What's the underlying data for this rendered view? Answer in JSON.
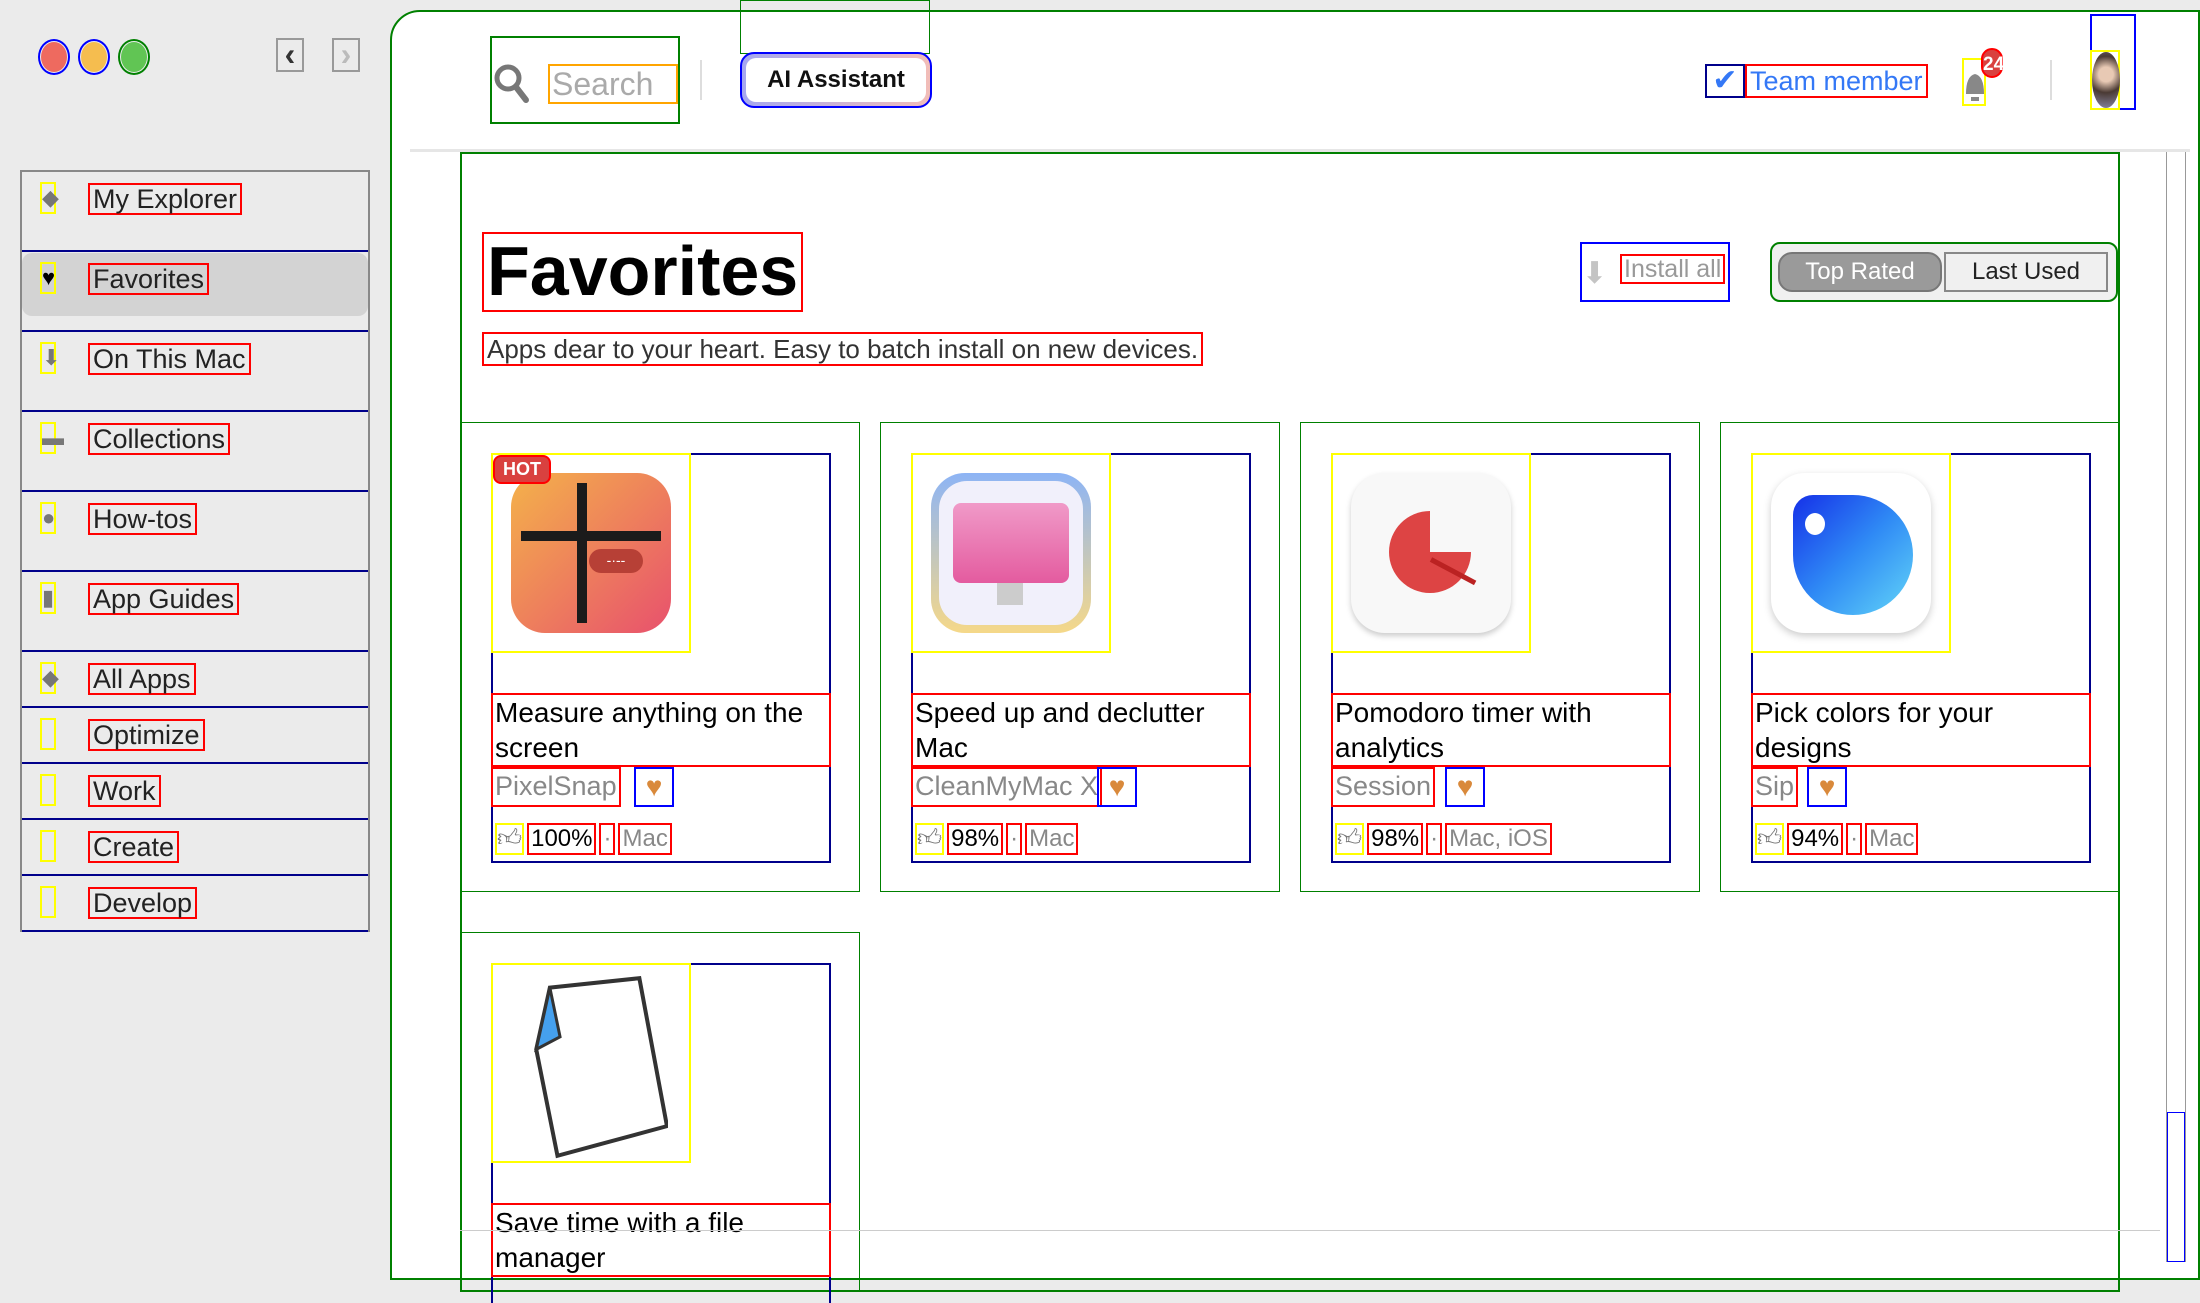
{
  "window": {
    "controls": [
      "close",
      "minimize",
      "zoom"
    ],
    "colors": {
      "close": "#ee6a5f",
      "minimize": "#f5bd4f",
      "zoom": "#61c554"
    }
  },
  "nav": {
    "back": "‹",
    "forward": "›"
  },
  "sidebar": {
    "items": [
      {
        "label": "My Explorer",
        "icon": "explorer-icon",
        "glyph": "◆"
      },
      {
        "label": "Favorites",
        "icon": "heart-icon",
        "glyph": "♥",
        "active": true
      },
      {
        "label": "On This Mac",
        "icon": "download-arrow-icon",
        "glyph": "⬇"
      },
      {
        "label": "Collections",
        "icon": "folder-icon",
        "glyph": "▬"
      },
      {
        "label": "How-tos",
        "icon": "lightbulb-icon",
        "glyph": "●"
      },
      {
        "label": "App Guides",
        "icon": "book-icon",
        "glyph": "▮"
      },
      {
        "label": "All Apps",
        "icon": "diamond-icon",
        "glyph": "◆"
      },
      {
        "label": "Optimize",
        "icon": "optimize-icon",
        "glyph": ""
      },
      {
        "label": "Work",
        "icon": "work-icon",
        "glyph": ""
      },
      {
        "label": "Create",
        "icon": "create-icon",
        "glyph": ""
      },
      {
        "label": "Develop",
        "icon": "develop-icon",
        "glyph": ""
      }
    ]
  },
  "header": {
    "search_placeholder": "Search",
    "ai_button": "AI Assistant",
    "team_member": "Team member",
    "notifications_count": "24",
    "accent": "#3478f6"
  },
  "page": {
    "title": "Favorites",
    "subtitle": "Apps dear to your heart. Easy to batch install on new devices.",
    "install_all": "Install all",
    "segments": [
      "Top Rated",
      "Last Used"
    ],
    "selected_segment": "Top Rated"
  },
  "apps": [
    {
      "title": "Measure anything on the screen",
      "developer": "PixelSnap",
      "rating": "100%",
      "platforms": "Mac",
      "badge": "HOT"
    },
    {
      "title": "Speed up and declutter Mac",
      "developer": "CleanMyMac X",
      "rating": "98%",
      "platforms": "Mac"
    },
    {
      "title": "Pomodoro timer with analytics",
      "developer": "Session",
      "rating": "98%",
      "platforms": "Mac, iOS"
    },
    {
      "title": "Pick colors for your designs",
      "developer": "Sip",
      "rating": "94%",
      "platforms": "Mac"
    },
    {
      "title": "Save time with a file manager"
    }
  ],
  "separator": "·"
}
